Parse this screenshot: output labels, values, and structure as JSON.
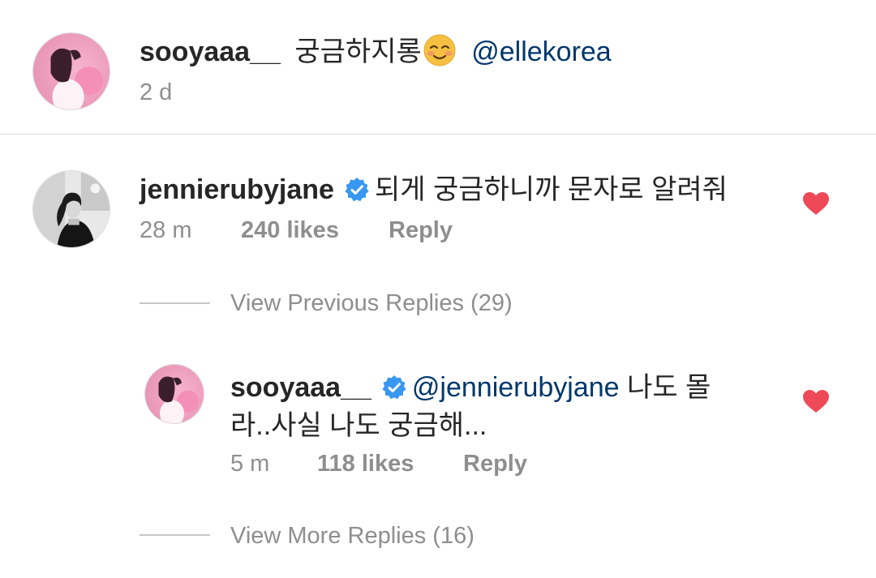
{
  "caption": {
    "username": "sooyaaa__",
    "text": "궁금하지롱",
    "emoji": "smiling-face-emoji",
    "mention": "@ellekorea",
    "time": "2 d"
  },
  "comment": {
    "username": "jennierubyjane",
    "text": "되게 궁금하니까 문자로 알려줘",
    "time": "28 m",
    "likes": "240 likes",
    "reply_label": "Reply",
    "liked": true
  },
  "view_previous_replies": "View Previous Replies (29)",
  "reply": {
    "username": "sooyaaa__",
    "mention": "@jennierubyjane",
    "text_line1": "나도 몰",
    "text_line2": "라..사실 나도 궁금해...",
    "time": "5 m",
    "likes": "118 likes",
    "reply_label": "Reply",
    "liked": true
  },
  "view_more_replies": "View More Replies (16)",
  "colors": {
    "heart": "#ed4956",
    "verified": "#3897f0",
    "mention": "#00376b",
    "muted": "#8e8e8e"
  }
}
